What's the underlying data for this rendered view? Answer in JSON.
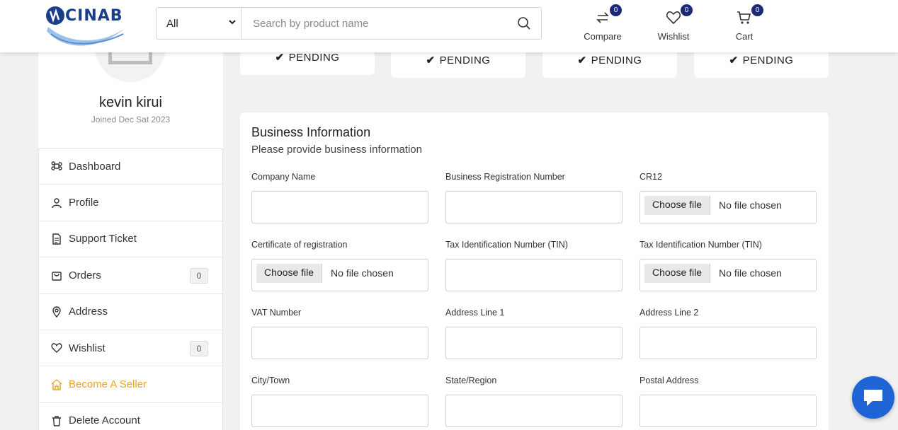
{
  "header": {
    "logo_text": "CINAB",
    "search": {
      "category": "All",
      "placeholder": "Search by product name"
    },
    "icons": [
      {
        "label": "Compare",
        "count": "0",
        "icon": "compare-icon"
      },
      {
        "label": "Wishlist",
        "count": "0",
        "icon": "heart-icon"
      },
      {
        "label": "Cart",
        "count": "0",
        "icon": "cart-icon"
      }
    ]
  },
  "profile": {
    "name": "kevin kirui",
    "joined": "Joined Dec Sat 2023"
  },
  "menu": [
    {
      "label": "Dashboard",
      "icon": "command-icon"
    },
    {
      "label": "Profile",
      "icon": "user-icon"
    },
    {
      "label": "Support Ticket",
      "icon": "ticket-icon"
    },
    {
      "label": "Orders",
      "icon": "bag-icon",
      "count": "0"
    },
    {
      "label": "Address",
      "icon": "location-icon"
    },
    {
      "label": "Wishlist",
      "icon": "heart-icon",
      "count": "0"
    },
    {
      "label": "Become A Seller",
      "icon": "store-icon"
    },
    {
      "label": "Delete Account",
      "icon": "trash-icon"
    }
  ],
  "status_cards": [
    "PENDING",
    "PENDING",
    "PENDING",
    "PENDING"
  ],
  "business": {
    "title": "Business Information",
    "subtitle": "Please provide business information",
    "file_button": "Choose file",
    "file_status": "No file chosen",
    "fields": [
      {
        "label": "Company Name",
        "type": "text"
      },
      {
        "label": "Business Registration Number",
        "type": "text"
      },
      {
        "label": "CR12",
        "type": "file"
      },
      {
        "label": "Certificate of registration",
        "type": "file"
      },
      {
        "label": "Tax Identification Number (TIN)",
        "type": "text"
      },
      {
        "label": "Tax Identification Number (TIN)",
        "type": "file"
      },
      {
        "label": "VAT Number",
        "type": "text"
      },
      {
        "label": "Address Line 1",
        "type": "text"
      },
      {
        "label": "Address Line 2",
        "type": "text"
      },
      {
        "label": "City/Town",
        "type": "text"
      },
      {
        "label": "State/Region",
        "type": "text"
      },
      {
        "label": "Postal Address",
        "type": "text"
      }
    ]
  },
  "colors": {
    "accent": "#f0a31c",
    "badge": "#1b2a78",
    "chat": "#1f64d6"
  }
}
